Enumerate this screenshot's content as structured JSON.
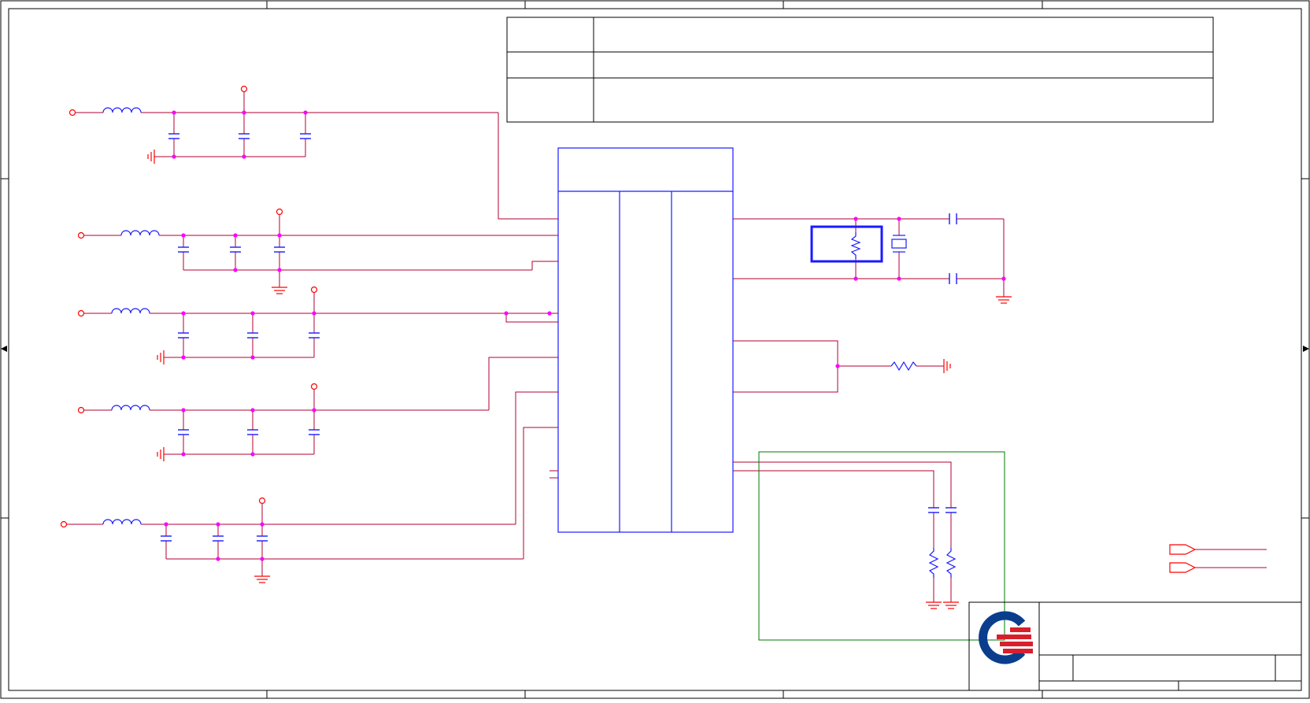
{
  "sheet": {
    "title": "",
    "colors": {
      "wire": "#b30033",
      "component": "#1a1aff",
      "junction": "#ff00ff",
      "power": "#ff0000",
      "frame": "#000000",
      "highlight": "#007a00",
      "logo_blue": "#0a3e8c",
      "logo_red": "#d8202c"
    },
    "logo": {
      "name": "company-logo-icon"
    },
    "notes_table": {
      "rows": [
        "",
        "",
        ""
      ]
    }
  }
}
